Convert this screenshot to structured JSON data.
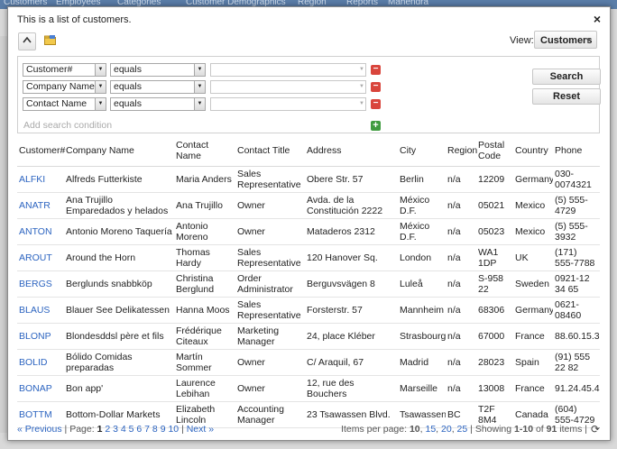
{
  "background": {
    "nav": [
      "Customers",
      "Employees",
      "Categories",
      "Customer Demographics",
      "Region",
      "Reports",
      "Mahendra"
    ]
  },
  "dialog": {
    "title": "This is a list of customers.",
    "close": "×",
    "view_label": "View:",
    "view_value": "Customers"
  },
  "search": {
    "conditions": [
      {
        "field": "Customer#",
        "op": "equals"
      },
      {
        "field": "Company Name",
        "op": "equals"
      },
      {
        "field": "Contact Name",
        "op": "equals"
      }
    ],
    "add_label": "Add search condition",
    "search_button": "Search",
    "reset_button": "Reset"
  },
  "table": {
    "columns": [
      "Customer#",
      "Company Name",
      "Contact Name",
      "Contact Title",
      "Address",
      "City",
      "Region",
      "Postal Code",
      "Country",
      "Phone"
    ],
    "rows": [
      [
        "ALFKI",
        "Alfreds Futterkiste",
        "Maria Anders",
        "Sales Representative",
        "Obere Str. 57",
        "Berlin",
        "n/a",
        "12209",
        "Germany",
        "030-0074321"
      ],
      [
        "ANATR",
        "Ana Trujillo Emparedados y helados",
        "Ana Trujillo",
        "Owner",
        "Avda. de la Constitución 2222",
        "México D.F.",
        "n/a",
        "05021",
        "Mexico",
        "(5) 555-4729"
      ],
      [
        "ANTON",
        "Antonio Moreno Taquería",
        "Antonio Moreno",
        "Owner",
        "Mataderos 2312",
        "México D.F.",
        "n/a",
        "05023",
        "Mexico",
        "(5) 555-3932"
      ],
      [
        "AROUT",
        "Around the Horn",
        "Thomas Hardy",
        "Sales Representative",
        "120 Hanover Sq.",
        "London",
        "n/a",
        "WA1 1DP",
        "UK",
        "(171) 555-7788"
      ],
      [
        "BERGS",
        "Berglunds snabbköp",
        "Christina Berglund",
        "Order Administrator",
        "Berguvsvägen 8",
        "Luleå",
        "n/a",
        "S-958 22",
        "Sweden",
        "0921-12 34 65"
      ],
      [
        "BLAUS",
        "Blauer See Delikatessen",
        "Hanna Moos",
        "Sales Representative",
        "Forsterstr. 57",
        "Mannheim",
        "n/a",
        "68306",
        "Germany",
        "0621-08460"
      ],
      [
        "BLONP",
        "Blondesddsl père et fils",
        "Frédérique Citeaux",
        "Marketing Manager",
        "24, place Kléber",
        "Strasbourg",
        "n/a",
        "67000",
        "France",
        "88.60.15.31"
      ],
      [
        "BOLID",
        "Bólido Comidas preparadas",
        "Martín Sommer",
        "Owner",
        "C/ Araquil, 67",
        "Madrid",
        "n/a",
        "28023",
        "Spain",
        "(91) 555 22 82"
      ],
      [
        "BONAP",
        "Bon app'",
        "Laurence Lebihan",
        "Owner",
        "12, rue des Bouchers",
        "Marseille",
        "n/a",
        "13008",
        "France",
        "91.24.45.40"
      ],
      [
        "BOTTM",
        "Bottom-Dollar Markets",
        "Elizabeth Lincoln",
        "Accounting Manager",
        "23 Tsawassen Blvd.",
        "Tsawassen",
        "BC",
        "T2F 8M4",
        "Canada",
        "(604) 555-4729"
      ]
    ]
  },
  "pager": {
    "previous": "« Previous",
    "page_label": "Page:",
    "pages": [
      "1",
      "2",
      "3",
      "4",
      "5",
      "6",
      "7",
      "8",
      "9",
      "10"
    ],
    "current_page": "1",
    "next": "Next »",
    "items_per_page_label": "Items per page:",
    "items_per_page_options": [
      "10",
      "15",
      "20",
      "25"
    ],
    "items_per_page_current": "10",
    "showing_prefix": "Showing",
    "showing_range": "1-10",
    "showing_of": "of",
    "showing_total": "91",
    "showing_suffix": "items"
  },
  "icons": {
    "collapse": "chevron-up-icon",
    "folder": "folder-icon",
    "remove": "minus-icon",
    "add": "plus-icon",
    "refresh": "refresh-icon"
  },
  "colors": {
    "link": "#2c64c0",
    "remove": "#d9453c",
    "add": "#3f9b3f"
  }
}
